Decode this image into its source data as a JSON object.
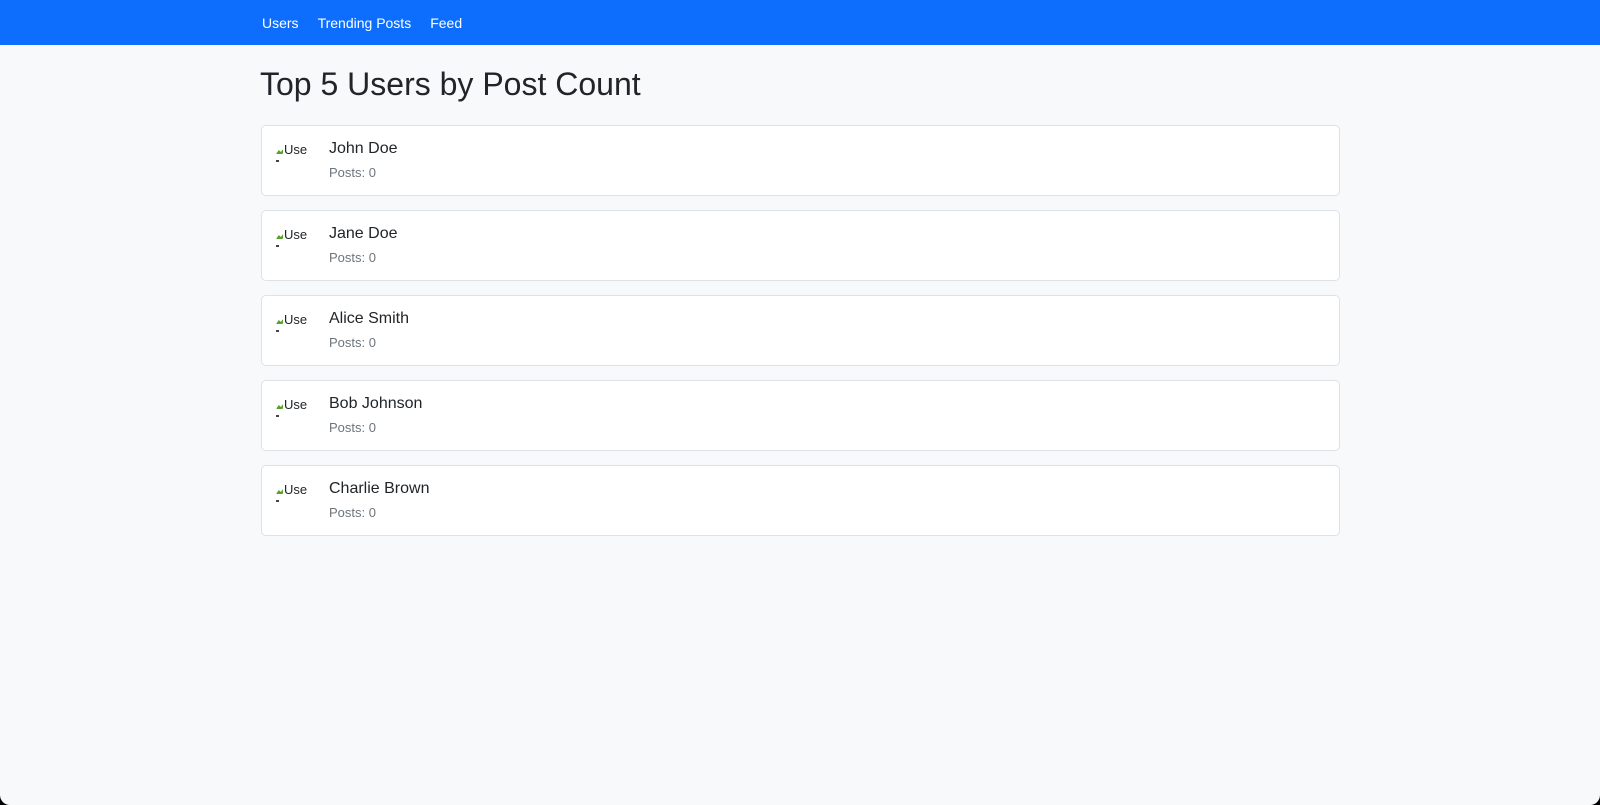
{
  "navbar": {
    "links": [
      "Users",
      "Trending Posts",
      "Feed"
    ]
  },
  "page": {
    "title": "Top 5 Users by Post Count"
  },
  "users": [
    {
      "name": "John Doe",
      "posts_label": "Posts: 0",
      "avatar_alt": "Use"
    },
    {
      "name": "Jane Doe",
      "posts_label": "Posts: 0",
      "avatar_alt": "Use"
    },
    {
      "name": "Alice Smith",
      "posts_label": "Posts: 0",
      "avatar_alt": "Use"
    },
    {
      "name": "Bob Johnson",
      "posts_label": "Posts: 0",
      "avatar_alt": "Use"
    },
    {
      "name": "Charlie Brown",
      "posts_label": "Posts: 0",
      "avatar_alt": "Use"
    }
  ],
  "colors": {
    "navbar": "#0d6efd",
    "background": "#f8f9fa",
    "card_border": "#dee2e6",
    "muted_text": "#6c757d"
  }
}
